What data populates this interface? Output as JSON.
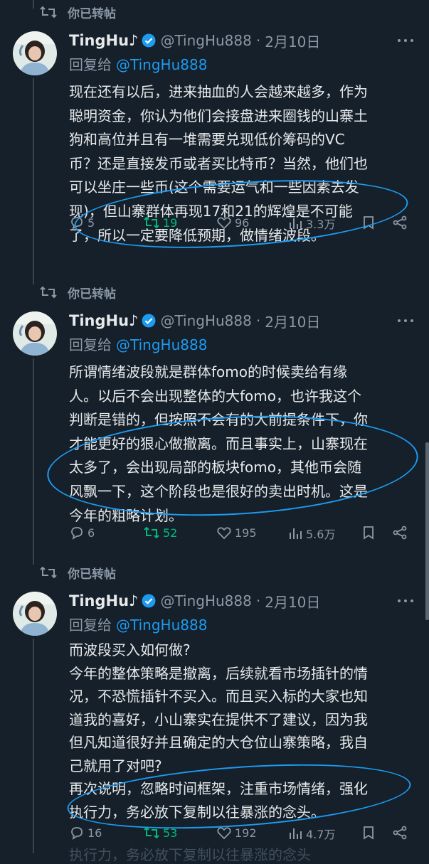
{
  "tweets": [
    {
      "retweet_label": "你已转帖",
      "display_name": "TingHu♪",
      "handle": "@TingHu888",
      "separator": "·",
      "date": "2月10日",
      "reply_prefix": "回复给",
      "reply_handle": "@TingHu888",
      "lines": [
        "现在还有以后，进来抽血的人会越来越多，作为",
        "聪明资金，你认为他们会接盘进来圈钱的山寨土",
        "狗和高位并且有一堆需要兑现低价筹码的VC",
        "币？还是直接发币或者买比特币？当然，他们也",
        "可以坐庄一些币(这个需要运气和一些因素去发",
        "现)，但山寨群体再现17和21的辉煌是不可能",
        "了，所以一定要降低预期，做情绪波段。"
      ],
      "replies": "5",
      "retweets": "19",
      "likes": "96",
      "views": "3.3万"
    },
    {
      "retweet_label": "你已转帖",
      "display_name": "TingHu♪",
      "handle": "@TingHu888",
      "separator": "·",
      "date": "2月10日",
      "reply_prefix": "回复给",
      "reply_handle": "@TingHu888",
      "lines": [
        "所谓情绪波段就是群体fomo的时候卖给有缘",
        "人。以后不会出现整体的大fomo，也许我这个",
        "判断是错的，但按照不会有的大前提条件下，你",
        "才能更好的狠心做撤离。而且事实上，山寨现在",
        "太多了，会出现局部的板块fomo，其他币会随",
        "风飘一下，这个阶段也是很好的卖出时机。这是",
        "今年的粗略计划。"
      ],
      "replies": "6",
      "retweets": "52",
      "likes": "195",
      "views": "5.6万"
    },
    {
      "retweet_label": "你已转帖",
      "display_name": "TingHu♪",
      "handle": "@TingHu888",
      "separator": "·",
      "date": "2月10日",
      "reply_prefix": "回复给",
      "reply_handle": "@TingHu888",
      "lines": [
        "而波段买入如何做?",
        "今年的整体策略是撤离，后续就看市场插针的情",
        "况，不恐慌插针不买入。而且买入标的大家也知",
        "道我的喜好，小山寨实在提供不了建议，因为我",
        "但凡知道很好并且确定的大仓位山寨策略，我自",
        "己就用了对吧?",
        "再次说明，忽略时间框架，注重市场情绪，强化",
        "执行力，务必放下复制以往暴涨的念头。"
      ],
      "replies": "16",
      "retweets": "53",
      "likes": "192",
      "views": "4.7万"
    }
  ],
  "bottom_cut_text": "执行力，务必放下复制以往暴涨的念头",
  "colors": {
    "background": "#15202b",
    "text": "#e7e9ea",
    "secondary": "#8b98a5",
    "link": "#1d9bf0",
    "retweet_green": "#00ba7c",
    "annotation_circle": "#1d9bf0"
  }
}
